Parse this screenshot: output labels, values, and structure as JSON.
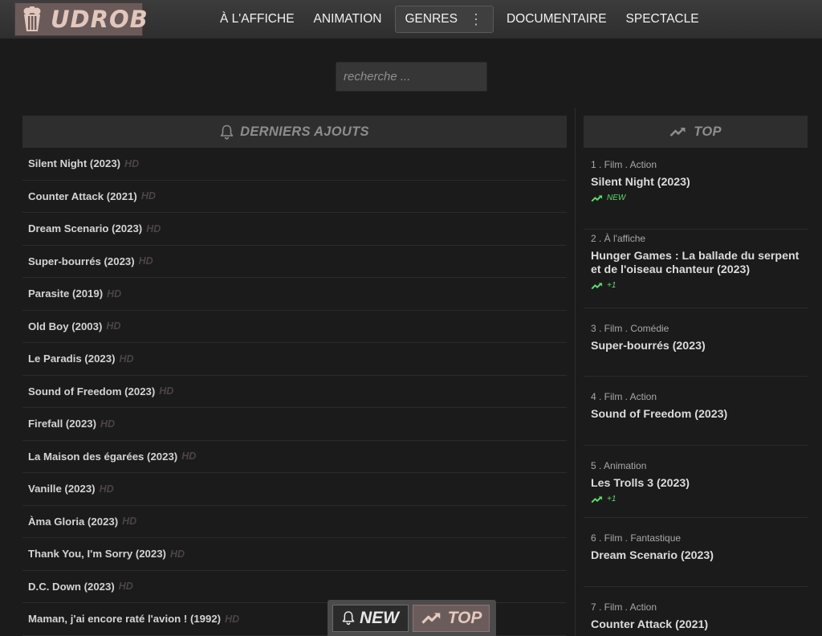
{
  "brand": {
    "name": "UDROB"
  },
  "nav": [
    {
      "label": "À L'AFFICHE"
    },
    {
      "label": "ANIMATION"
    },
    {
      "label": "GENRES",
      "active": true
    },
    {
      "label": "DOCUMENTAIRE"
    },
    {
      "label": "SPECTACLE"
    }
  ],
  "search": {
    "placeholder": "recherche ..."
  },
  "recent": {
    "heading": "DERNIERS AJOUTS",
    "icon": "bell-icon",
    "items": [
      {
        "title": "Silent Night (2023)",
        "quality": "HD"
      },
      {
        "title": "Counter Attack (2021)",
        "quality": "HD"
      },
      {
        "title": "Dream Scenario (2023)",
        "quality": "HD"
      },
      {
        "title": "Super-bourrés (2023)",
        "quality": "HD"
      },
      {
        "title": "Parasite (2019)",
        "quality": "HD"
      },
      {
        "title": "Old Boy (2003)",
        "quality": "HD"
      },
      {
        "title": "Le Paradis (2023)",
        "quality": "HD"
      },
      {
        "title": "Sound of Freedom (2023)",
        "quality": "HD"
      },
      {
        "title": "Firefall (2023)",
        "quality": "HD"
      },
      {
        "title": "La Maison des égarées (2023)",
        "quality": "HD"
      },
      {
        "title": "Vanille (2023)",
        "quality": "HD"
      },
      {
        "title": "Àma Gloria (2023)",
        "quality": "HD"
      },
      {
        "title": "Thank You, I'm Sorry (2023)",
        "quality": "HD"
      },
      {
        "title": "D.C. Down (2023)",
        "quality": "HD"
      },
      {
        "title": "Maman, j'ai encore raté l'avion ! (1992)",
        "quality": "HD"
      }
    ]
  },
  "top": {
    "heading": "TOP",
    "icon": "trending-up-icon",
    "items": [
      {
        "meta": "1 . Film . Action",
        "title": "Silent Night (2023)",
        "badge": "NEW"
      },
      {
        "meta": "2 . À l'affiche",
        "title": "Hunger Games : La ballade du serpent et de l'oiseau chanteur (2023)",
        "badge": "+1"
      },
      {
        "meta": "3 . Film . Comédie",
        "title": "Super-bourrés (2023)",
        "badge": ""
      },
      {
        "meta": "4 . Film . Action",
        "title": "Sound of Freedom (2023)",
        "badge": ""
      },
      {
        "meta": "5 . Animation",
        "title": "Les Trolls 3 (2023)",
        "badge": "+1"
      },
      {
        "meta": "6 . Film . Fantastique",
        "title": "Dream Scenario (2023)",
        "badge": ""
      },
      {
        "meta": "7 . Film . Action",
        "title": "Counter Attack (2021)",
        "badge": ""
      }
    ]
  },
  "bottom_bar": {
    "new_label": "NEW",
    "top_label": "TOP"
  },
  "colors": {
    "background": "#1b1b1b",
    "header": "#363636",
    "logo_bg": "#6a5a5a",
    "logo_text": "#e2c7bc",
    "accent_green": "#5ddc6c",
    "hd_tag": "#4d4444"
  }
}
